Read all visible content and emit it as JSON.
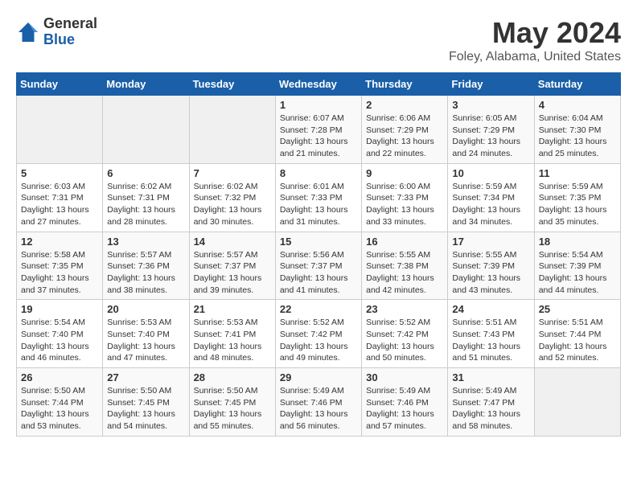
{
  "header": {
    "logo_general": "General",
    "logo_blue": "Blue",
    "title": "May 2024",
    "subtitle": "Foley, Alabama, United States"
  },
  "weekdays": [
    "Sunday",
    "Monday",
    "Tuesday",
    "Wednesday",
    "Thursday",
    "Friday",
    "Saturday"
  ],
  "weeks": [
    [
      {
        "day": "",
        "info": ""
      },
      {
        "day": "",
        "info": ""
      },
      {
        "day": "",
        "info": ""
      },
      {
        "day": "1",
        "info": "Sunrise: 6:07 AM\nSunset: 7:28 PM\nDaylight: 13 hours\nand 21 minutes."
      },
      {
        "day": "2",
        "info": "Sunrise: 6:06 AM\nSunset: 7:29 PM\nDaylight: 13 hours\nand 22 minutes."
      },
      {
        "day": "3",
        "info": "Sunrise: 6:05 AM\nSunset: 7:29 PM\nDaylight: 13 hours\nand 24 minutes."
      },
      {
        "day": "4",
        "info": "Sunrise: 6:04 AM\nSunset: 7:30 PM\nDaylight: 13 hours\nand 25 minutes."
      }
    ],
    [
      {
        "day": "5",
        "info": "Sunrise: 6:03 AM\nSunset: 7:31 PM\nDaylight: 13 hours\nand 27 minutes."
      },
      {
        "day": "6",
        "info": "Sunrise: 6:02 AM\nSunset: 7:31 PM\nDaylight: 13 hours\nand 28 minutes."
      },
      {
        "day": "7",
        "info": "Sunrise: 6:02 AM\nSunset: 7:32 PM\nDaylight: 13 hours\nand 30 minutes."
      },
      {
        "day": "8",
        "info": "Sunrise: 6:01 AM\nSunset: 7:33 PM\nDaylight: 13 hours\nand 31 minutes."
      },
      {
        "day": "9",
        "info": "Sunrise: 6:00 AM\nSunset: 7:33 PM\nDaylight: 13 hours\nand 33 minutes."
      },
      {
        "day": "10",
        "info": "Sunrise: 5:59 AM\nSunset: 7:34 PM\nDaylight: 13 hours\nand 34 minutes."
      },
      {
        "day": "11",
        "info": "Sunrise: 5:59 AM\nSunset: 7:35 PM\nDaylight: 13 hours\nand 35 minutes."
      }
    ],
    [
      {
        "day": "12",
        "info": "Sunrise: 5:58 AM\nSunset: 7:35 PM\nDaylight: 13 hours\nand 37 minutes."
      },
      {
        "day": "13",
        "info": "Sunrise: 5:57 AM\nSunset: 7:36 PM\nDaylight: 13 hours\nand 38 minutes."
      },
      {
        "day": "14",
        "info": "Sunrise: 5:57 AM\nSunset: 7:37 PM\nDaylight: 13 hours\nand 39 minutes."
      },
      {
        "day": "15",
        "info": "Sunrise: 5:56 AM\nSunset: 7:37 PM\nDaylight: 13 hours\nand 41 minutes."
      },
      {
        "day": "16",
        "info": "Sunrise: 5:55 AM\nSunset: 7:38 PM\nDaylight: 13 hours\nand 42 minutes."
      },
      {
        "day": "17",
        "info": "Sunrise: 5:55 AM\nSunset: 7:39 PM\nDaylight: 13 hours\nand 43 minutes."
      },
      {
        "day": "18",
        "info": "Sunrise: 5:54 AM\nSunset: 7:39 PM\nDaylight: 13 hours\nand 44 minutes."
      }
    ],
    [
      {
        "day": "19",
        "info": "Sunrise: 5:54 AM\nSunset: 7:40 PM\nDaylight: 13 hours\nand 46 minutes."
      },
      {
        "day": "20",
        "info": "Sunrise: 5:53 AM\nSunset: 7:40 PM\nDaylight: 13 hours\nand 47 minutes."
      },
      {
        "day": "21",
        "info": "Sunrise: 5:53 AM\nSunset: 7:41 PM\nDaylight: 13 hours\nand 48 minutes."
      },
      {
        "day": "22",
        "info": "Sunrise: 5:52 AM\nSunset: 7:42 PM\nDaylight: 13 hours\nand 49 minutes."
      },
      {
        "day": "23",
        "info": "Sunrise: 5:52 AM\nSunset: 7:42 PM\nDaylight: 13 hours\nand 50 minutes."
      },
      {
        "day": "24",
        "info": "Sunrise: 5:51 AM\nSunset: 7:43 PM\nDaylight: 13 hours\nand 51 minutes."
      },
      {
        "day": "25",
        "info": "Sunrise: 5:51 AM\nSunset: 7:44 PM\nDaylight: 13 hours\nand 52 minutes."
      }
    ],
    [
      {
        "day": "26",
        "info": "Sunrise: 5:50 AM\nSunset: 7:44 PM\nDaylight: 13 hours\nand 53 minutes."
      },
      {
        "day": "27",
        "info": "Sunrise: 5:50 AM\nSunset: 7:45 PM\nDaylight: 13 hours\nand 54 minutes."
      },
      {
        "day": "28",
        "info": "Sunrise: 5:50 AM\nSunset: 7:45 PM\nDaylight: 13 hours\nand 55 minutes."
      },
      {
        "day": "29",
        "info": "Sunrise: 5:49 AM\nSunset: 7:46 PM\nDaylight: 13 hours\nand 56 minutes."
      },
      {
        "day": "30",
        "info": "Sunrise: 5:49 AM\nSunset: 7:46 PM\nDaylight: 13 hours\nand 57 minutes."
      },
      {
        "day": "31",
        "info": "Sunrise: 5:49 AM\nSunset: 7:47 PM\nDaylight: 13 hours\nand 58 minutes."
      },
      {
        "day": "",
        "info": ""
      }
    ]
  ]
}
